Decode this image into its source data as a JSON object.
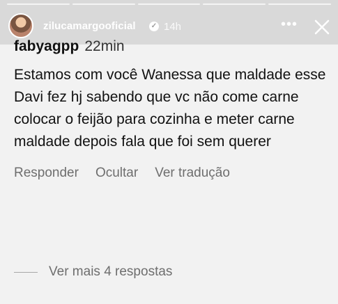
{
  "story_header": {
    "username": "zilucamargooficial",
    "time": "14h"
  },
  "comment": {
    "username": "fabyagpp",
    "time": "22min",
    "text": "Estamos com você Wanessa que maldade esse Davi fez hj sabendo que vc não come carne colocar o feijão para cozinha e meter carne maldade depois fala que foi sem querer"
  },
  "actions": {
    "reply": "Responder",
    "hide": "Ocultar",
    "translate": "Ver tradução"
  },
  "replies": {
    "more": "Ver mais 4 respostas"
  },
  "icons": {
    "more": "more-icon",
    "close": "close-icon",
    "verified": "verified-icon"
  },
  "colors": {
    "background": "#f2f2f2",
    "header": "#d9d9d9",
    "text": "#111111",
    "muted_text": "#6e6e6e"
  }
}
